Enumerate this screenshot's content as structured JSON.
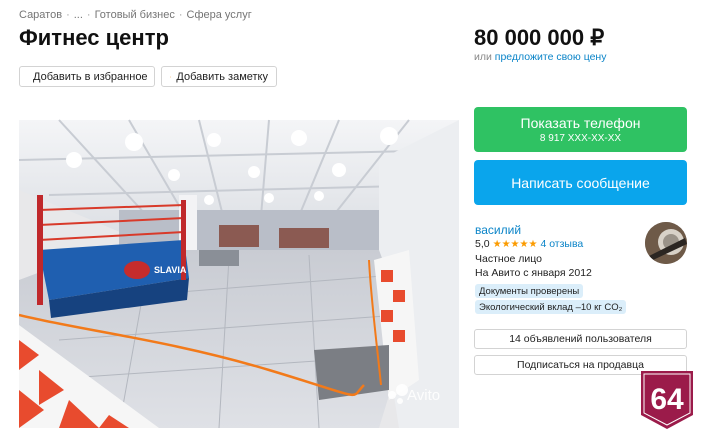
{
  "breadcrumbs": [
    "Саратов",
    "...",
    "Готовый бизнес",
    "Сфера услуг"
  ],
  "breadcrumb_sep": "·",
  "title": "Фитнес центр",
  "actions": {
    "favorite_label": "Добавить в избранное",
    "note_label": "Добавить заметку"
  },
  "price": {
    "value": "80 000 000 ₽",
    "offer_prefix": "или",
    "offer_link": "предложите свою цену"
  },
  "contact": {
    "phone_label": "Показать телефон",
    "phone_masked": "8 917 XXX-XX-XX",
    "message_label": "Написать сообщение"
  },
  "seller": {
    "name": "василий",
    "rating": "5,0",
    "stars": "★★★★★",
    "reviews": "4 отзыва",
    "type": "Частное лицо",
    "since": "На Авито с января 2012",
    "badges": [
      "Документы проверены",
      "Экологический вклад –10 кг CO₂"
    ],
    "ads_button": "14 объявлений пользователя",
    "subscribe_button": "Подписаться на продавца"
  },
  "photo": {
    "watermark": "Avito",
    "ring_logo": "SLAVIA"
  },
  "corner_logo": "64",
  "colors": {
    "phone_button": "#2fc263",
    "message_button": "#0aa5ec",
    "link": "#0a84c8",
    "badge_bg": "#dbeefa",
    "star": "#fb9b00",
    "corner_logo": "#9b1b4a"
  }
}
